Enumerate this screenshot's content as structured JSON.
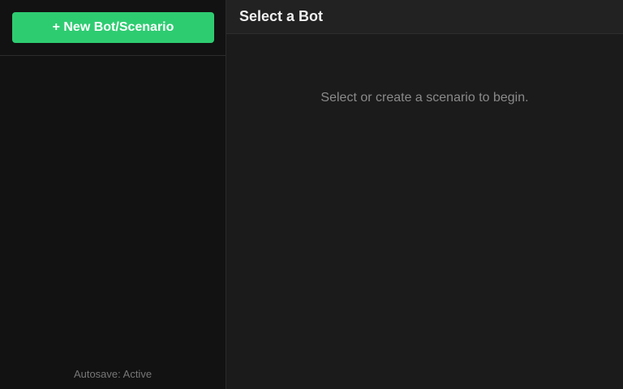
{
  "sidebar": {
    "new_button_label": "+ New Bot/Scenario",
    "autosave_status": "Autosave: Active"
  },
  "main": {
    "title": "Select a Bot",
    "empty_message": "Select or create a scenario to begin."
  },
  "colors": {
    "accent": "#2ecc71",
    "sidebar_bg": "#121212",
    "main_bg": "#1b1b1b",
    "header_bg": "#222222"
  }
}
